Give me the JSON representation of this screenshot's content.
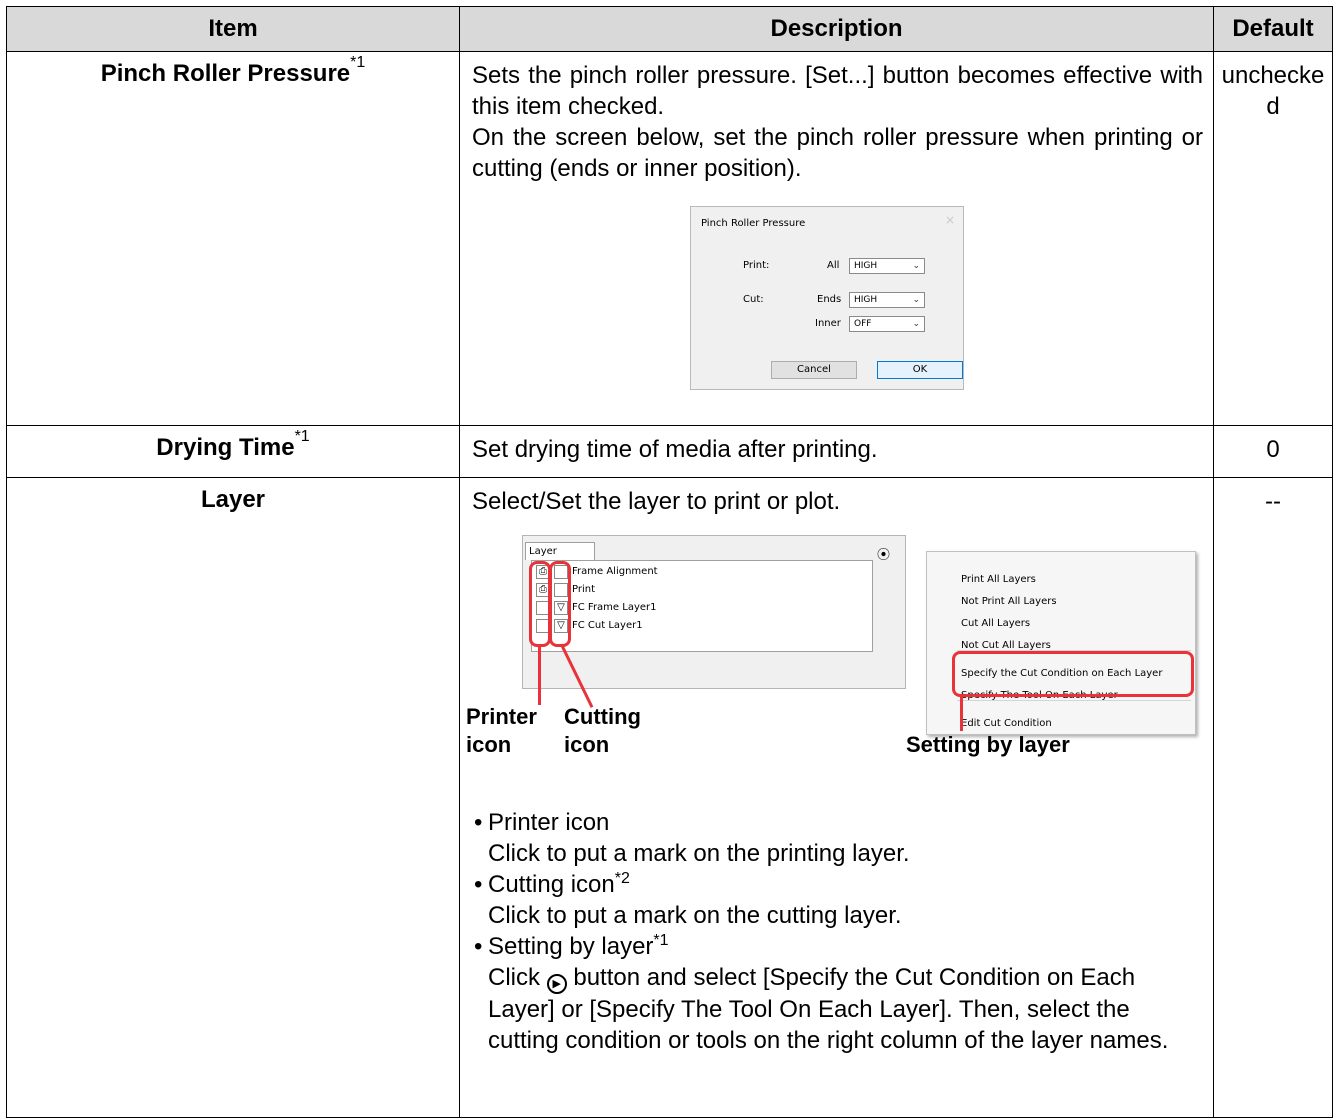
{
  "table": {
    "headers": [
      "Item",
      "Description",
      "Default"
    ],
    "rows": {
      "pinch": {
        "item": "Pinch Roller Pressure",
        "note": "*1",
        "desc1": "Sets the pinch roller pressure. [Set...] button becomes effective with this item checked.",
        "desc2": "On the screen below, set the pinch roller pressure when printing or cutting (ends or inner position).",
        "default": "unchecked"
      },
      "drying": {
        "item": "Drying Time",
        "note": "*1",
        "desc": "Set drying time of media after printing.",
        "default": "0"
      },
      "layer": {
        "item": "Layer",
        "desc": "Select/Set the layer to print or plot.",
        "default": "--",
        "bullets": [
          {
            "title": "Printer icon",
            "note": "",
            "text": "Click to put a mark on the printing layer."
          },
          {
            "title": "Cutting icon",
            "note": "*2",
            "text": "Click to put a mark on the cutting layer."
          },
          {
            "title": "Setting by layer",
            "note": "*1",
            "text_before": "Click",
            "text_after": "button and select [Specify the Cut Condition on Each Layer] or [Specify The Tool On Each Layer]. Then, select the cutting condition or tools on the right column of the layer names."
          }
        ]
      }
    }
  },
  "dialog": {
    "title": "Pinch Roller Pressure",
    "close": "×",
    "print_label": "Print:",
    "cut_label": "Cut:",
    "all_label": "All",
    "ends_label": "Ends",
    "inner_label": "Inner",
    "all_value": "HIGH",
    "ends_value": "HIGH",
    "inner_value": "OFF",
    "cancel": "Cancel",
    "ok": "OK"
  },
  "layer_panel": {
    "tab": "Layer",
    "layers": [
      "Frame Alignment",
      "Print",
      "FC Frame Layer1",
      "FC Cut Layer1"
    ],
    "menu": {
      "items": [
        "Print All Layers",
        "Not Print All Layers",
        "Cut All Layers",
        "Not Cut All Layers"
      ],
      "highlighted": [
        "Specify the Cut Condition on Each Layer",
        "Specify The Tool On Each Layer"
      ],
      "last": "Edit Cut Condition"
    },
    "labels": {
      "printer_icon": "Printer icon",
      "cutting_icon": "Cutting icon",
      "setting_by_layer": "Setting by layer"
    }
  },
  "colors": {
    "header_bg": "#d9d9d9",
    "highlight_red": "#e8333a"
  }
}
